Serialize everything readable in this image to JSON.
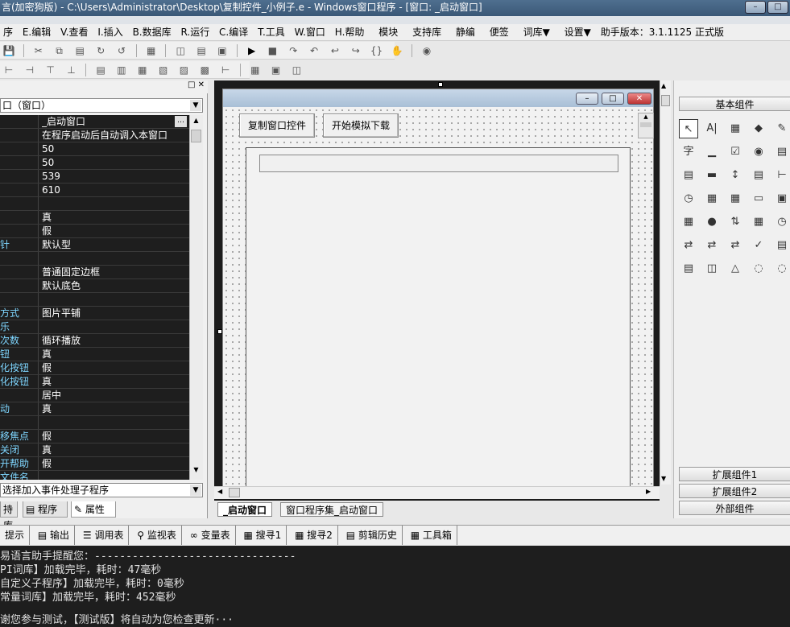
{
  "title_bar": {
    "text": "言(加密狗版) - C:\\Users\\Administrator\\Desktop\\复制控件_小例子.e - Windows窗口程序 - [窗口: _启动窗口]"
  },
  "menu": {
    "items": [
      "序",
      "E.编辑",
      "V.查看",
      "I.插入",
      "B.数据库",
      "R.运行",
      "C.编译",
      "T.工具",
      "W.窗口",
      "H.帮助",
      "模块",
      "支持库",
      "静编",
      "便签",
      "词库▼",
      "设置▼",
      "助手版本：3.1.1125 正式版"
    ]
  },
  "left_panel": {
    "window_combo": "口（窗口）",
    "properties": [
      {
        "name": "",
        "value": "_启动窗口"
      },
      {
        "name": "",
        "value": "在程序启动后自动调入本窗口"
      },
      {
        "name": "",
        "value": "50"
      },
      {
        "name": "",
        "value": "50"
      },
      {
        "name": "",
        "value": "539"
      },
      {
        "name": "",
        "value": "610"
      },
      {
        "name": "",
        "value": ""
      },
      {
        "name": "",
        "value": "真"
      },
      {
        "name": "",
        "value": "假"
      },
      {
        "name": "针",
        "value": "默认型"
      },
      {
        "name": "",
        "value": ""
      },
      {
        "name": "",
        "value": "普通固定边框"
      },
      {
        "name": "",
        "value": "默认底色"
      },
      {
        "name": "",
        "value": ""
      },
      {
        "name": "方式",
        "value": "图片平铺"
      },
      {
        "name": "乐",
        "value": ""
      },
      {
        "name": "次数",
        "value": "循环播放"
      },
      {
        "name": "钮",
        "value": "真"
      },
      {
        "name": "化按钮",
        "value": "假"
      },
      {
        "name": "化按钮",
        "value": "真"
      },
      {
        "name": "",
        "value": "居中"
      },
      {
        "name": "动",
        "value": "真"
      },
      {
        "name": "",
        "value": ""
      },
      {
        "name": "移焦点",
        "value": "假"
      },
      {
        "name": "关闭",
        "value": "真"
      },
      {
        "name": "开帮助",
        "value": "假"
      },
      {
        "name": "文件名",
        "value": ""
      }
    ],
    "event_combo": "选择加入事件处理子程序",
    "tabs": [
      "持库",
      "程序",
      "属性"
    ]
  },
  "designer": {
    "button1": "复制窗口控件",
    "button2": "开始模拟下载",
    "tabs": [
      "_启动窗口",
      "窗口程序集_启动窗口"
    ]
  },
  "right_panel": {
    "header": "基本组件",
    "footers": [
      "扩展组件1",
      "扩展组件2",
      "外部组件"
    ]
  },
  "bottom_tabs": [
    "提示",
    "输出",
    "调用表",
    "监视表",
    "变量表",
    "搜寻1",
    "搜寻2",
    "剪辑历史",
    "工具箱"
  ],
  "output_lines": [
    "易语言助手提醒您：--------------------------------",
    "PI词库】加载完毕，耗时：47毫秒",
    "自定义子程序】加载完毕，耗时：0毫秒",
    "常量词库】加载完毕，耗时：452毫秒",
    "",
    "谢您参与测试，【测试版】将自动为您检查更新···"
  ]
}
